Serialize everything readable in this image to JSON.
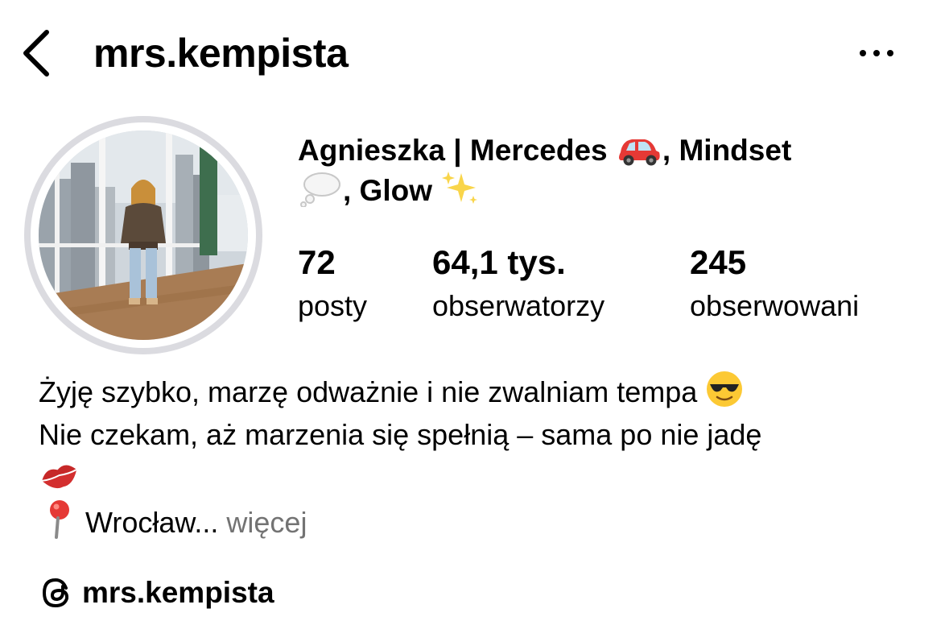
{
  "header": {
    "username": "mrs.kempista"
  },
  "profile": {
    "full_name_part1": "Agnieszka | Mercedes ",
    "full_name_part2": ", Mindset",
    "full_name_part3": ", Glow ",
    "emoji_car": "red-car-icon",
    "emoji_thought": "thought-balloon-icon",
    "emoji_sparkles": "sparkles-icon"
  },
  "stats": [
    {
      "value": "72",
      "label": "posty"
    },
    {
      "value": "64,1 tys.",
      "label": "obserwatorzy"
    },
    {
      "value": "245",
      "label": "obserwowani"
    }
  ],
  "bio": {
    "line1": "Żyję szybko, marzę odważnie i nie zwalniam tempa ",
    "line2": "Nie czekam, aż marzenia się spełnią – sama po nie jadę",
    "location": "Wrocław...",
    "more": "więcej"
  },
  "threads": {
    "handle": "mrs.kempista"
  },
  "colors": {
    "text": "#000000",
    "muted": "#737373",
    "ring": "#dbdbe0"
  }
}
